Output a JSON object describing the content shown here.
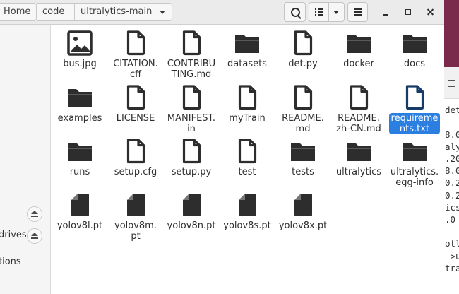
{
  "breadcrumb": {
    "home": "Home",
    "code": "code",
    "current": "ultralytics-main"
  },
  "sidebar": {
    "drives_label": "drives",
    "locations_label": "tions"
  },
  "terminal_lines": [
    "",
    "det",
    "",
    "8.0",
    "aly",
    ".20",
    "8.0",
    "0.2",
    "0.2",
    "ics",
    ".0-",
    "",
    "otl",
    "->u",
    "tra"
  ],
  "colors": {
    "selection": "#2a7fe0",
    "icon": "#2d2d2d",
    "selected_icon": "#173a66"
  },
  "files": [
    {
      "name": "bus.jpg",
      "icon": "image-file-icon"
    },
    {
      "name": "CITATION.cff",
      "label": "CITATION.\ncff",
      "icon": "document-file-icon"
    },
    {
      "name": "CONTRIBUTING.md",
      "label": "CONTRIBU\nTING.md",
      "icon": "document-file-icon"
    },
    {
      "name": "datasets",
      "icon": "folder-icon"
    },
    {
      "name": "det.py",
      "icon": "document-file-icon"
    },
    {
      "name": "docker",
      "icon": "folder-icon"
    },
    {
      "name": "docs",
      "icon": "folder-icon"
    },
    {
      "name": "examples",
      "icon": "folder-icon"
    },
    {
      "name": "LICENSE",
      "icon": "document-file-icon"
    },
    {
      "name": "MANIFEST.in",
      "label": "MANIFEST.\nin",
      "icon": "document-file-icon"
    },
    {
      "name": "myTrain",
      "icon": "document-file-icon"
    },
    {
      "name": "README.md",
      "label": "README.\nmd",
      "icon": "document-file-icon"
    },
    {
      "name": "README.zh-CN.md",
      "label": "README.\nzh-CN.md",
      "icon": "document-file-icon"
    },
    {
      "name": "requirements.txt",
      "label": "requireme\nnts.txt",
      "icon": "document-file-icon",
      "selected": true
    },
    {
      "name": "runs",
      "icon": "folder-icon"
    },
    {
      "name": "setup.cfg",
      "icon": "document-file-icon"
    },
    {
      "name": "setup.py",
      "icon": "document-file-icon"
    },
    {
      "name": "test",
      "icon": "document-file-icon"
    },
    {
      "name": "tests",
      "icon": "folder-icon"
    },
    {
      "name": "ultralytics",
      "icon": "folder-icon"
    },
    {
      "name": "ultralytics.egg-info",
      "label": "ultralytics.\negg-info",
      "icon": "folder-icon"
    },
    {
      "name": "yolov8l.pt",
      "icon": "binary-file-icon"
    },
    {
      "name": "yolov8m.pt",
      "label": "yolov8m.\npt",
      "icon": "binary-file-icon"
    },
    {
      "name": "yolov8n.pt",
      "icon": "binary-file-icon"
    },
    {
      "name": "yolov8s.pt",
      "icon": "binary-file-icon"
    },
    {
      "name": "yolov8x.pt",
      "icon": "binary-file-icon"
    }
  ]
}
